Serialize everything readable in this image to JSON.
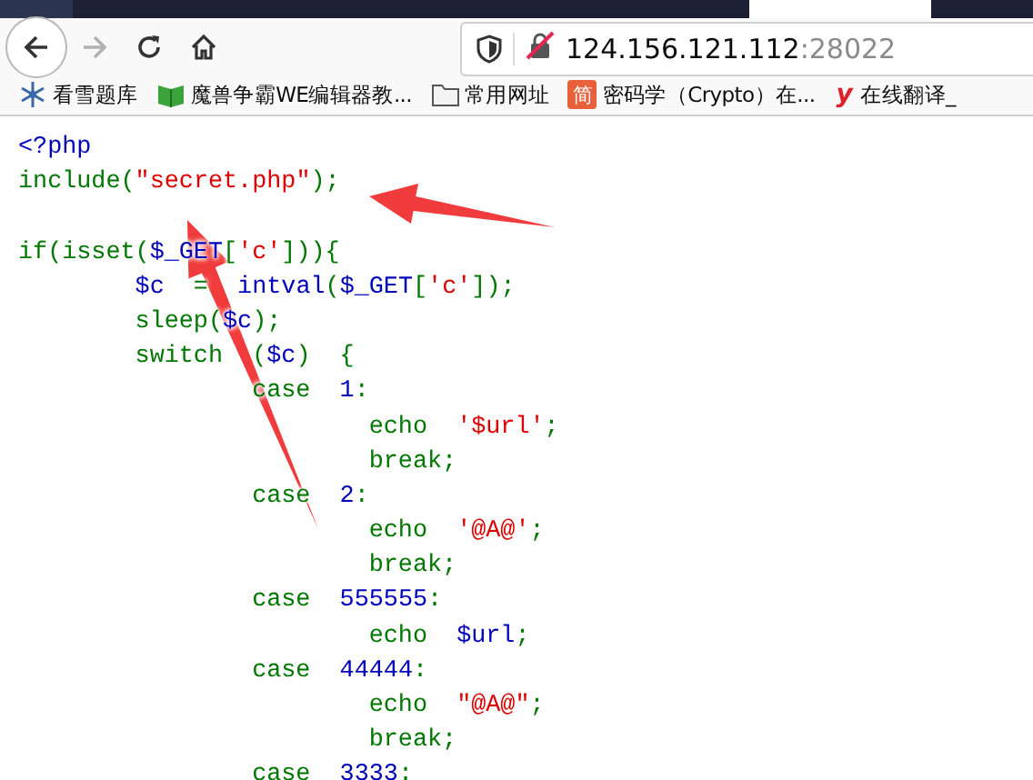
{
  "browser": {
    "back_enabled": true,
    "forward_enabled": false,
    "url_host": "124.156.121.112",
    "url_port": ":28022",
    "insecure": true
  },
  "bookmarks": [
    {
      "kind": "snowflake",
      "label": "看雪题库"
    },
    {
      "kind": "book",
      "label": "魔兽争霸WE编辑器教..."
    },
    {
      "kind": "folder",
      "label": "常用网址"
    },
    {
      "kind": "badge",
      "icon_text": "简",
      "label": "密码学（Crypto）在..."
    },
    {
      "kind": "letter",
      "icon_text": "y",
      "label": "在线翻译_"
    }
  ],
  "code_lines": [
    {
      "tokens": [
        {
          "kind": "default",
          "text": "<?php"
        }
      ]
    },
    {
      "tokens": [
        {
          "kind": "keyword",
          "text": "include("
        },
        {
          "kind": "string",
          "text": "\"secret.php\""
        },
        {
          "kind": "keyword",
          "text": ");"
        }
      ]
    },
    {
      "kind": "blank"
    },
    {
      "tokens": [
        {
          "kind": "keyword",
          "text": "if(isset("
        },
        {
          "kind": "default",
          "text": "$_GET"
        },
        {
          "kind": "keyword",
          "text": "["
        },
        {
          "kind": "string",
          "text": "'c'"
        },
        {
          "kind": "keyword",
          "text": "])){"
        }
      ]
    },
    {
      "tokens": [
        {
          "kind": "default",
          "text": "        $c"
        },
        {
          "kind": "keyword",
          "text": "  =  "
        },
        {
          "kind": "default",
          "text": "intval"
        },
        {
          "kind": "keyword",
          "text": "("
        },
        {
          "kind": "default",
          "text": "$_GET"
        },
        {
          "kind": "keyword",
          "text": "["
        },
        {
          "kind": "string",
          "text": "'c'"
        },
        {
          "kind": "keyword",
          "text": "]);"
        }
      ]
    },
    {
      "tokens": [
        {
          "kind": "keyword",
          "text": "        sleep("
        },
        {
          "kind": "default",
          "text": "$c"
        },
        {
          "kind": "keyword",
          "text": ");"
        }
      ]
    },
    {
      "tokens": [
        {
          "kind": "keyword",
          "text": "        switch  ("
        },
        {
          "kind": "default",
          "text": "$c"
        },
        {
          "kind": "keyword",
          "text": ")  {"
        }
      ]
    },
    {
      "tokens": [
        {
          "kind": "keyword",
          "text": "                case  "
        },
        {
          "kind": "default",
          "text": "1"
        },
        {
          "kind": "keyword",
          "text": ":"
        }
      ]
    },
    {
      "tokens": [
        {
          "kind": "keyword",
          "text": "                        echo  "
        },
        {
          "kind": "string",
          "text": "'$url'"
        },
        {
          "kind": "keyword",
          "text": ";"
        }
      ]
    },
    {
      "tokens": [
        {
          "kind": "keyword",
          "text": "                        break;"
        }
      ]
    },
    {
      "tokens": [
        {
          "kind": "keyword",
          "text": "                case  "
        },
        {
          "kind": "default",
          "text": "2"
        },
        {
          "kind": "keyword",
          "text": ":"
        }
      ]
    },
    {
      "tokens": [
        {
          "kind": "keyword",
          "text": "                        echo  "
        },
        {
          "kind": "string",
          "text": "'@A@'"
        },
        {
          "kind": "keyword",
          "text": ";"
        }
      ]
    },
    {
      "tokens": [
        {
          "kind": "keyword",
          "text": "                        break;"
        }
      ]
    },
    {
      "tokens": [
        {
          "kind": "keyword",
          "text": "                case  "
        },
        {
          "kind": "default",
          "text": "555555"
        },
        {
          "kind": "keyword",
          "text": ":"
        }
      ]
    },
    {
      "tokens": [
        {
          "kind": "keyword",
          "text": "                        echo  "
        },
        {
          "kind": "default",
          "text": "$url"
        },
        {
          "kind": "keyword",
          "text": ";"
        }
      ]
    },
    {
      "tokens": [
        {
          "kind": "keyword",
          "text": "                case  "
        },
        {
          "kind": "default",
          "text": "44444"
        },
        {
          "kind": "keyword",
          "text": ":"
        }
      ]
    },
    {
      "tokens": [
        {
          "kind": "keyword",
          "text": "                        echo  "
        },
        {
          "kind": "string",
          "text": "\"@A@\""
        },
        {
          "kind": "keyword",
          "text": ";"
        }
      ]
    },
    {
      "tokens": [
        {
          "kind": "keyword",
          "text": "                        break;"
        }
      ]
    },
    {
      "tokens": [
        {
          "kind": "keyword",
          "text": "                case  "
        },
        {
          "kind": "default",
          "text": "3333"
        },
        {
          "kind": "keyword",
          "text": ":"
        }
      ]
    }
  ],
  "annotations": [
    {
      "kind": "arrow"
    },
    {
      "kind": "arrow"
    }
  ]
}
